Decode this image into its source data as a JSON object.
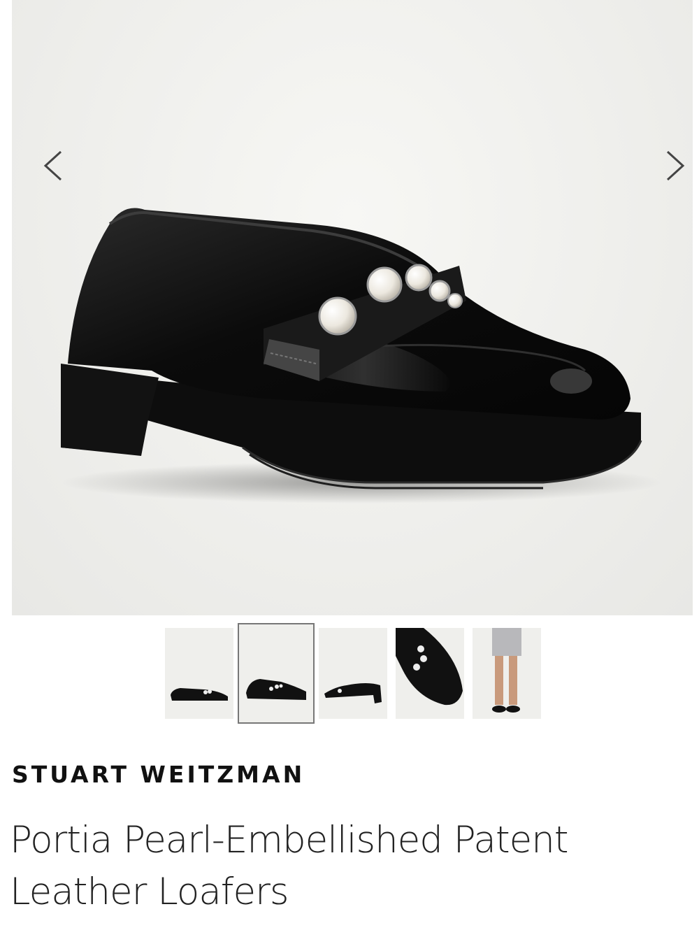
{
  "gallery": {
    "prev_icon": "chevron-left-icon",
    "next_icon": "chevron-right-icon",
    "thumbnails": [
      {
        "view": "side"
      },
      {
        "view": "three-quarter",
        "selected": true
      },
      {
        "view": "back-three-quarter"
      },
      {
        "view": "top-detail"
      },
      {
        "view": "on-model"
      }
    ]
  },
  "product": {
    "brand": "STUART WEITZMAN",
    "name": "Portia Pearl-Embellished Patent Leather Loafers"
  }
}
